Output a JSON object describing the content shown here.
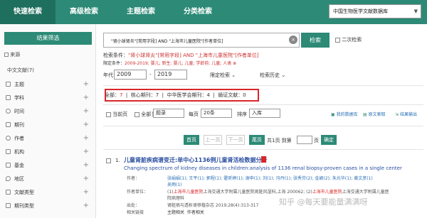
{
  "topnav": {
    "tabs": [
      {
        "label": "快速检索"
      },
      {
        "label": "高级检索"
      },
      {
        "label": "主题检索"
      },
      {
        "label": "分类检索"
      }
    ],
    "database_select": "中国生物医学文献数据库"
  },
  "sidebar": {
    "header": "结果筛选",
    "source_label": "来源",
    "source_value": "中文文献(7)",
    "facets": [
      {
        "label": "主题"
      },
      {
        "label": "学科"
      },
      {
        "label": "时间"
      },
      {
        "label": "期刊"
      },
      {
        "label": "作者"
      },
      {
        "label": "机构"
      },
      {
        "label": "基金"
      },
      {
        "label": "地区"
      },
      {
        "label": "文献类型"
      },
      {
        "label": "期刊类型"
      }
    ]
  },
  "search": {
    "query": "\"肾小球肾炎\"[常用字段] AND \"上海市儿童医院\"[作者单位]",
    "button": "检索",
    "secondary_label": "二次检索",
    "condition_prefix": "检索条件：",
    "condition_text": "\"肾小球肾炎\"[常用字段] AND \"上海市儿童医院\"[作者单位]",
    "limit_prefix": "限定条件：",
    "limit_text": "2009-2019; 婴儿; 新生: 婴儿; 儿童; 学龄前: 儿童; 人类",
    "year_label": "年代",
    "year_from": "2009",
    "year_to": "2019",
    "year_sep": "-",
    "limit_dd": "限定检索",
    "history_dd": "检索历史"
  },
  "counts": {
    "all_label": "全部：",
    "all_value": "7",
    "core_label": "核心期刊：7",
    "cma_label": "中华医学会期刊：4",
    "cited_label": "循证文献：0"
  },
  "toolbar": {
    "current_page": "当前页",
    "select_all": "全部",
    "display_label": "显示",
    "display_value": "题录",
    "per_page_label": "每页",
    "per_page_value": "20条",
    "sort_label": "排序",
    "sort_value": "入库",
    "my_db": "我的数据库",
    "raw_export": "原文索取",
    "result_export": "结果输出"
  },
  "pager": {
    "first": "首页",
    "prev": "上一页",
    "next": "下一页",
    "last": "尾页",
    "total_text": "共1页  到第",
    "page_suffix": "页",
    "confirm": "确定"
  },
  "record": {
    "index": "1.",
    "title": "儿童肾脏疾病谱变迁:单中心1136例儿童肾活检数据分析",
    "title_en": "Changing spectrum of kidney diseases in children:analysis of 1136 renal biopsy-proven cases in a single center",
    "author_label": "作者：",
    "authors": "张娟娟(1); 王平(1); 郭程(1); 霍昕婷(1); 谢申(1); 刘(1); 冯丹(1); 张秀芬(2); 金颖(2); 朱光华(1); 黄文彦(1)",
    "authors_extra": "吴雨(1)",
    "org_label": "作者单位：",
    "org_pre": "(1)",
    "org_red1": "上海市儿童医院",
    "org_mid": "上海交通大学附属儿童医院肾脏风湿科,上海 200062; (2)",
    "org_red2": "上海市儿童医院",
    "org_post": "上海交通大学附属儿童医",
    "org_extra": "院病理科",
    "source_label": "出处：",
    "source": "肾脏病与透析肾移植杂志 2019;28(4):313-317",
    "related_label": "相关链接",
    "rel_topic": "主题相关",
    "rel_author": "作者相关"
  },
  "watermark": "知乎 @每天要能量满满呀"
}
